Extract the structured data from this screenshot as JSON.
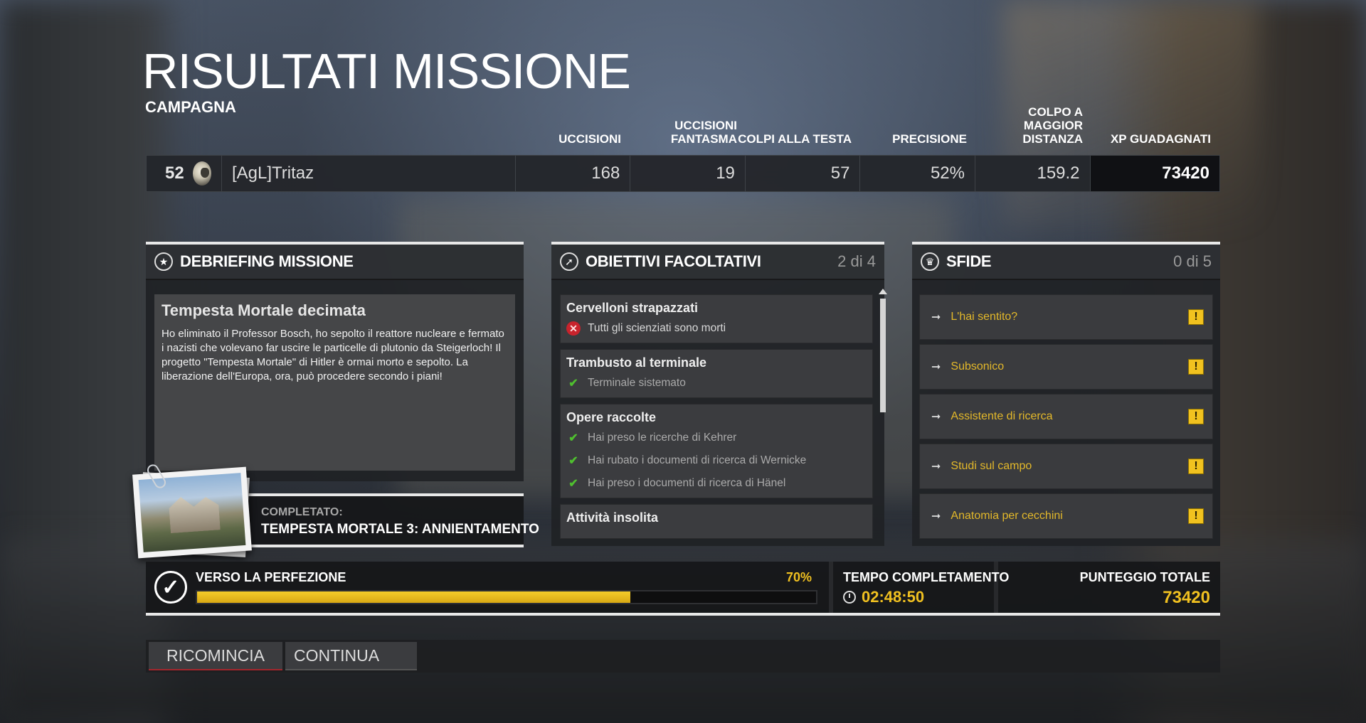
{
  "header": {
    "title": "RISULTATI MISSIONE",
    "subtitle": "CAMPAGNA"
  },
  "score_table": {
    "columns": {
      "kills": "UCCISIONI",
      "ghost_kills": "UCCISIONI FANTASMA",
      "headshots": "COLPI ALLA TESTA",
      "accuracy": "PRECISIONE",
      "longest_shot": "COLPO A MAGGIOR DISTANZA",
      "xp": "XP GUADAGNATI"
    },
    "row": {
      "rank": "52",
      "player": "[AgL]Tritaz",
      "kills": "168",
      "ghost_kills": "19",
      "headshots": "57",
      "accuracy": "52%",
      "longest_shot": "159.2",
      "xp": "73420"
    }
  },
  "debriefing": {
    "title": "DEBRIEFING MISSIONE",
    "heading": "Tempesta Mortale decimata",
    "text": "Ho eliminato il Professor Bosch, ho sepolto il reattore nucleare e fermato i nazisti che volevano far uscire le particelle di plutonio da Steigerloch! Il progetto \"Tempesta Mortale\" di Hitler è ormai morto e sepolto. La liberazione dell'Europa, ora, può procedere secondo i piani!",
    "completed_label": "COMPLETATO:",
    "completed_value": "TEMPESTA MORTALE 3: ANNIENTAMENTO"
  },
  "objectives": {
    "title": "OBIETTIVI FACOLTATIVI",
    "count": "2 di 4",
    "cards": [
      {
        "title": "Cervelloni strapazzati",
        "items": [
          {
            "text": "Tutti gli scienziati sono morti",
            "status": "fail"
          }
        ]
      },
      {
        "title": "Trambusto al terminale",
        "items": [
          {
            "text": "Terminale sistemato",
            "status": "done"
          }
        ]
      },
      {
        "title": "Opere raccolte",
        "items": [
          {
            "text": "Hai preso le ricerche di Kehrer",
            "status": "done"
          },
          {
            "text": "Hai rubato i documenti di ricerca di Wernicke",
            "status": "done"
          },
          {
            "text": "Hai preso i documenti di ricerca di Hänel",
            "status": "done"
          }
        ]
      },
      {
        "title": "Attività insolita",
        "items": []
      }
    ]
  },
  "challenges": {
    "title": "SFIDE",
    "count": "0 di 5",
    "items": [
      "L'hai sentito?",
      "Subsonico",
      "Assistente di ricerca",
      "Studi sul campo",
      "Anatomia per cecchini"
    ]
  },
  "perfection": {
    "label": "VERSO LA PERFEZIONE",
    "percent_text": "70%",
    "percent": 70
  },
  "completion_time": {
    "label": "TEMPO COMPLETAMENTO",
    "value": "02:48:50"
  },
  "total_score": {
    "label": "PUNTEGGIO TOTALE",
    "value": "73420"
  },
  "buttons": {
    "restart": "RICOMINCIA",
    "continue": "CONTINUA"
  },
  "colors": {
    "accent_yellow": "#f0c020",
    "fail_red": "#c8232c",
    "check_green": "#4fbf2f"
  }
}
